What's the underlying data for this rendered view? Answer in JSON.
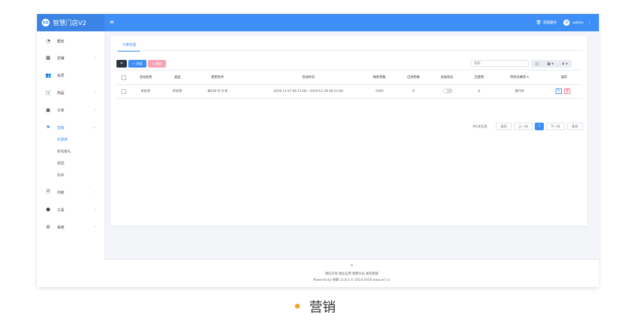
{
  "header": {
    "brand_logo_text": "KD",
    "brand_name": "智慧门店V2",
    "menu_toggle_icon": "hamburger-icon",
    "clear_cache": "清理缓存",
    "avatar_letter": "W",
    "user": "admin"
  },
  "sidebar": {
    "items": [
      {
        "label": "概览",
        "icon": "dashboard-icon",
        "arrow": ""
      },
      {
        "label": "店铺",
        "icon": "grid-icon",
        "arrow": "›"
      },
      {
        "label": "会员",
        "icon": "users-icon",
        "arrow": ""
      },
      {
        "label": "商品",
        "icon": "cart-icon",
        "arrow": "›"
      },
      {
        "label": "订单",
        "icon": "order-icon",
        "arrow": "›"
      },
      {
        "label": "营销",
        "icon": "flag-icon",
        "arrow": "⌄"
      },
      {
        "label": "内容",
        "icon": "document-icon",
        "arrow": "›"
      },
      {
        "label": "工具",
        "icon": "cube-icon",
        "arrow": "›"
      },
      {
        "label": "系统",
        "icon": "gear-icon",
        "arrow": "›"
      }
    ],
    "sub_items": [
      "优惠券",
      "折扣有礼",
      "拼团",
      "秒杀"
    ]
  },
  "main": {
    "tab": "卡券管理",
    "toolbar": {
      "refresh_icon": "refresh-icon",
      "add_label": "+ 添加",
      "delete_label": "× 删除",
      "search_placeholder": "搜索",
      "tools": [
        "◫",
        "▦ ▾",
        "⬇ ▾"
      ]
    },
    "table": {
      "headers": [
        "活动名称",
        "类型",
        "使用条件",
        "活动时间",
        "剩余券数",
        "已领券数",
        "发放状态",
        "已使用",
        "所有优惠券 ▾",
        "操作"
      ],
      "rows": [
        {
          "name": "折扣券",
          "type": "折扣券",
          "condition": "满100 打 8 折",
          "time": "2019-11-07 00:11:00 - 2019-11-30 00:11:00",
          "remaining": "1000",
          "claimed": "0",
          "released": false,
          "used": "0",
          "status": "进行中"
        }
      ]
    },
    "pagination": {
      "info": "共1条信息",
      "first": "首页",
      "prev": "上一页",
      "current": "1",
      "next": "下一页",
      "last": "末页"
    }
  },
  "footer": {
    "logo": "⊙",
    "links": "微信开发 微信应用 微擎论坛 联系客服",
    "powered": "Powered by 微擎 v1.8.2 © 2014-2018 www.w7.cc"
  },
  "caption": "营销",
  "colors": {
    "primary": "#3e8ef7",
    "danger_light": "#f5a3b5",
    "dark_button": "#2a3541",
    "caption_dot": "#f5a623"
  }
}
